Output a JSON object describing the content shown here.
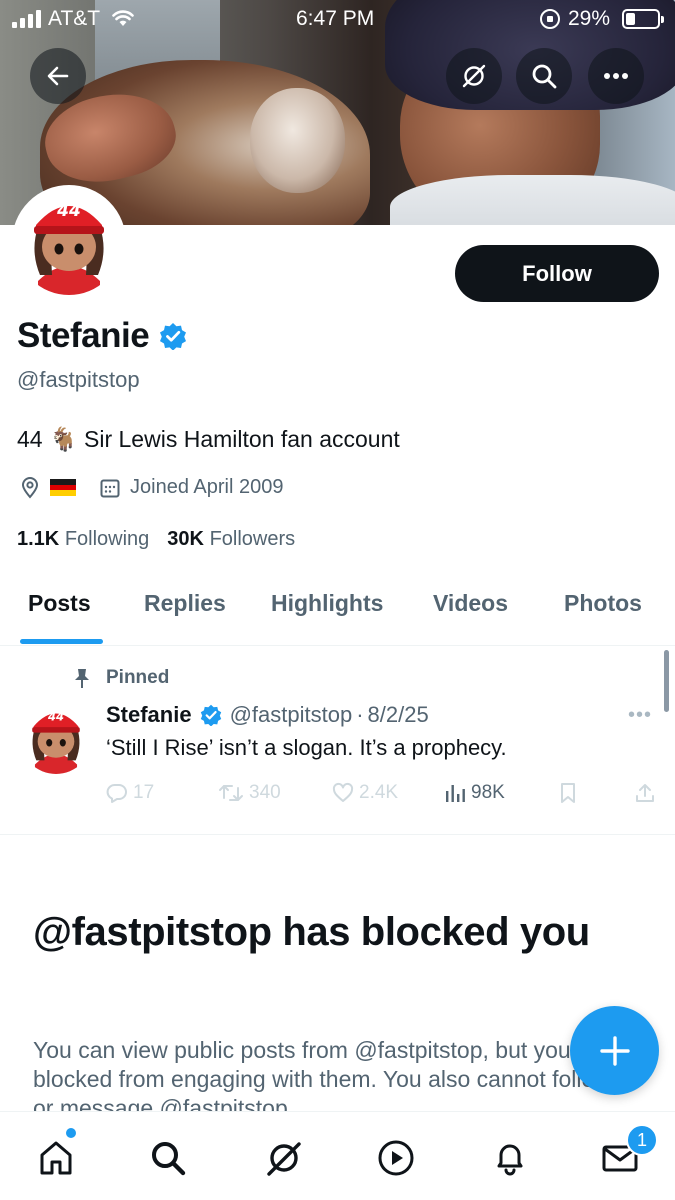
{
  "status_bar": {
    "carrier": "AT&T",
    "time": "6:47 PM",
    "battery_percent": "29%",
    "battery_level": 0.29
  },
  "banner": {
    "buttons": [
      "back-arrow-icon",
      "grok-icon",
      "search-icon",
      "more-icon"
    ]
  },
  "profile": {
    "avatar_badge": "44",
    "follow_label": "Follow",
    "display_name": "Stefanie",
    "verified": true,
    "handle": "@fastpitstop",
    "bio_prefix": "44",
    "bio_emoji": "🐐",
    "bio_text": "Sir Lewis Hamilton fan account",
    "location_flag": "germany-flag",
    "joined": "Joined April 2009",
    "following_count": "1.1K",
    "following_label": "Following",
    "followers_count": "30K",
    "followers_label": "Followers"
  },
  "tabs": {
    "posts": "Posts",
    "replies": "Replies",
    "highlights": "Highlights",
    "videos": "Videos",
    "photos": "Photos",
    "active": "Posts"
  },
  "pinned_post": {
    "pinned_label": "Pinned",
    "author": "Stefanie",
    "handle": "@fastpitstop",
    "separator": "·",
    "date": "8/2/25",
    "text": "‘Still I Rise’ isn’t a slogan. It’s a prophecy.",
    "replies": "17",
    "reposts": "340",
    "likes": "2.4K",
    "views": "98K"
  },
  "blocked": {
    "title": "@fastpitstop has blocked you",
    "body": "You can view public posts from @fastpitstop, but you are blocked from engaging with them. You also cannot follow or message @fastpitstop."
  },
  "bottom_nav": {
    "items": [
      "home-icon",
      "search-icon",
      "grok-icon",
      "video-icon",
      "notifications-icon",
      "messages-icon"
    ],
    "messages_badge": "1"
  },
  "colors": {
    "accent": "#1d9bf0",
    "text_primary": "#0f1419",
    "text_secondary": "#536471",
    "follow_button": "#0f1419"
  }
}
